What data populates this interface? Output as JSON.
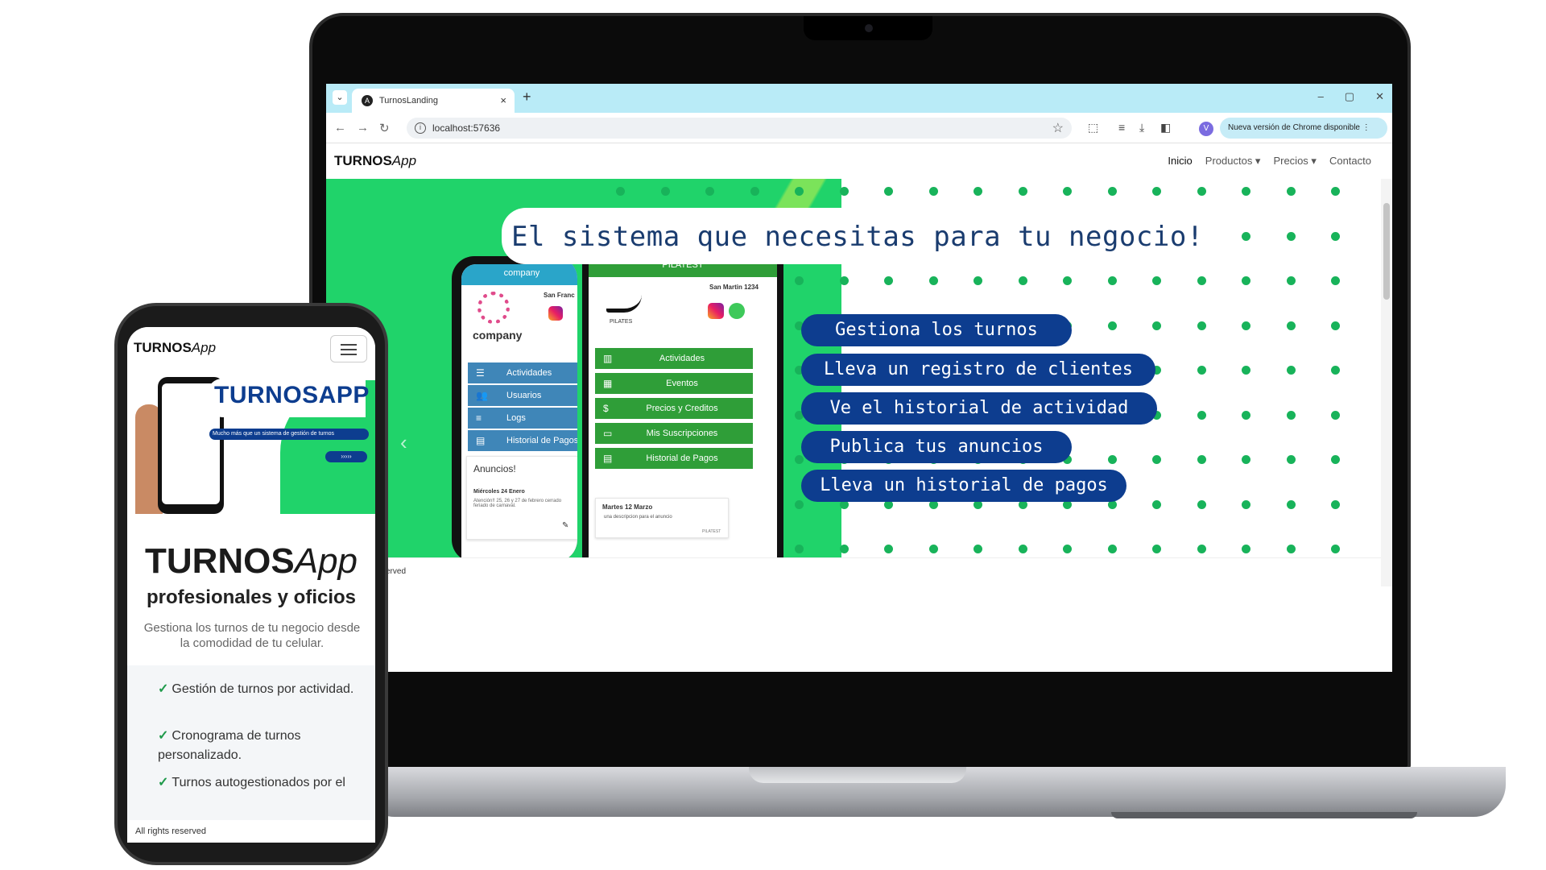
{
  "browser": {
    "tab_title": "TurnosLanding",
    "tab_close": "×",
    "tab_new": "+",
    "url": "localhost:57636",
    "profile_initial": "V",
    "update_label": "Nueva versión de Chrome disponible",
    "window_controls": {
      "minimize": "–",
      "maximize": "▢",
      "close": "✕"
    }
  },
  "site": {
    "brand_main": "TURNOS",
    "brand_italic": "App",
    "nav": {
      "inicio": "Inicio",
      "productos": "Productos ▾",
      "precios": "Precios ▾",
      "contacto": "Contacto"
    },
    "hero": {
      "headline": "El sistema que necesitas para tu negocio!",
      "features": [
        "Gestiona los turnos",
        "Lleva un registro de clientes",
        "Ve el historial de actividad",
        "Publica tus anuncios",
        "Lleva un historial de pagos"
      ],
      "prev_arrow": "‹"
    },
    "footer_partial": "erved",
    "mock_left": {
      "header": "company",
      "city": "San Franc",
      "logo_text": "company",
      "buttons": [
        "Actividades",
        "Usuarios",
        "Logs",
        "Historial de Pagos"
      ],
      "announcements_title": "Anuncios!",
      "announcement_date": "Miércoles 24 Enero",
      "announcement_text": "Atención!! 25, 26 y 27 de febrero cerrado feriado de carnaval."
    },
    "mock_right": {
      "header": "PILATEST",
      "address": "San Martin 1234",
      "logo_text": "PILATES",
      "buttons": [
        "Actividades",
        "Eventos",
        "Precios y Creditos",
        "Mis Suscripciones",
        "Historial de Pagos"
      ],
      "announcement_date": "Martes 12 Marzo",
      "announcement_text": "una descripcion para el anuncio",
      "announcement_sign": "PILATEST"
    }
  },
  "phone": {
    "brand_main": "TURNOS",
    "brand_italic": "App",
    "banner_title": "TURNOSAPP",
    "banner_sub": "Mucho más que un sistema de gestión de turnos",
    "banner_pill": "›››››",
    "h1_main": "TURNOS",
    "h1_italic": "App",
    "h2": "profesionales y oficios",
    "paragraph": "Gestiona los turnos de tu negocio desde la comodidad de tu celular.",
    "features": [
      "Gestión de turnos por actividad.",
      "Cronograma de turnos personalizado.",
      "Turnos autogestionados por el"
    ],
    "footer": "All rights reserved"
  }
}
